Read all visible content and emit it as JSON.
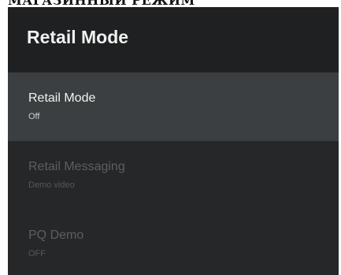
{
  "document": {
    "heading": "МАГАЗИННЫЙ РЕЖИМ"
  },
  "panel": {
    "title": "Retail Mode",
    "items": [
      {
        "label": "Retail Mode",
        "value": "Off",
        "state": "selected"
      },
      {
        "label": "Retail Messaging",
        "value": "Demo video",
        "state": "disabled"
      },
      {
        "label": "PQ Demo",
        "value": "OFF",
        "state": "disabled"
      }
    ]
  },
  "colors": {
    "panel_background": "#252728",
    "header_background": "#1f2021",
    "selected_background": "#3c3f41",
    "text_primary": "#f2f2f2",
    "text_disabled": "#5c5f61"
  }
}
